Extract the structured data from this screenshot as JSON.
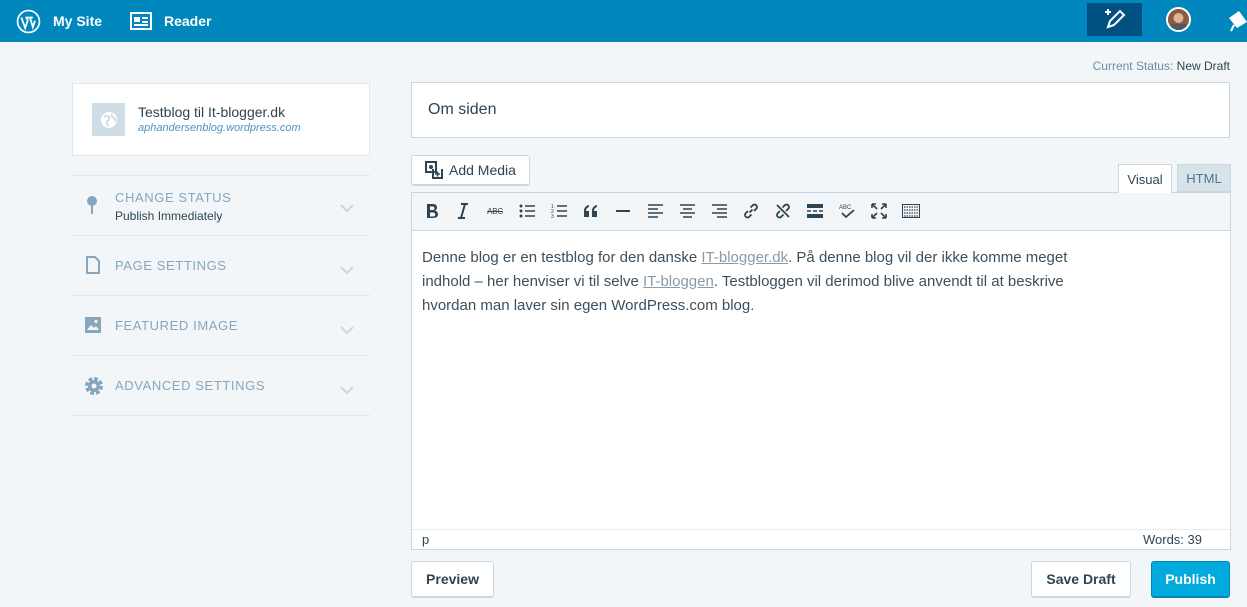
{
  "topbar": {
    "my_site_label": "My Site",
    "reader_label": "Reader"
  },
  "status": {
    "label": "Current Status:",
    "value": "New Draft"
  },
  "site": {
    "title": "Testblog til It-blogger.dk",
    "url": "aphandersenblog.wordpress.com"
  },
  "sidebar": {
    "sections": [
      {
        "title": "Change Status",
        "subtitle": "Publish Immediately",
        "icon": "pin-icon"
      },
      {
        "title": "Page Settings",
        "icon": "page-icon"
      },
      {
        "title": "Featured Image",
        "icon": "image-icon"
      },
      {
        "title": "Advanced Settings",
        "icon": "gear-icon"
      }
    ]
  },
  "editor": {
    "title_value": "Om siden",
    "add_media_label": "Add Media",
    "tab_visual": "Visual",
    "tab_html": "HTML",
    "content": {
      "p1": "Denne blog er en testblog for den danske ",
      "link1": "IT-blogger.dk",
      "p2": ". På denne blog vil der ikke komme meget indhold – her henviser vi til selve ",
      "link2": "IT-bloggen",
      "p3": ". Testbloggen vil derimod blive anvendt til at beskrive hvordan man laver sin egen WordPress.com blog."
    },
    "path": "p",
    "word_count": "Words: 39",
    "toolbar_buttons": [
      "bold",
      "italic",
      "strikethrough",
      "bullet-list",
      "numbered-list",
      "blockquote",
      "horizontal-rule",
      "align-left",
      "align-center",
      "align-right",
      "insert-link",
      "remove-link",
      "read-more",
      "spellcheck",
      "fullscreen",
      "toolbar-toggle"
    ]
  },
  "actions": {
    "preview_label": "Preview",
    "save_label": "Save Draft",
    "publish_label": "Publish"
  },
  "colors": {
    "topbar": "#0087be",
    "accent": "#00aadc",
    "background": "#f3f6f8"
  }
}
